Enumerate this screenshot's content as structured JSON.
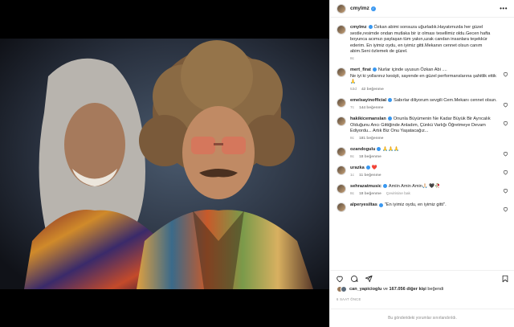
{
  "header": {
    "username": "cmylmz",
    "more_icon": "more-horizontal-icon"
  },
  "caption": {
    "username": "cmylmz",
    "text": "Özkan abimi sonsuza uğurladık.Hayatımızda her güzel sestle,resimde ondan mutlaka bir iz olması tesellimiz oldu.Gecen hafta boyunca acımızı paylaşan tüm yakın,uzak candan insanlara teşekkür ederim. En iyimiz oydu, en iyimiz gitti.Mekanın cennet olsun canım abim.Seni özlemek de güzel.",
    "time": "8c"
  },
  "comments": [
    {
      "username": "mert_firat",
      "verified": true,
      "text": "Nurlar içinde uyusun Özkan Abi ....\nNe iyi ki yollarınız kesişti, sayende en güzel performanslarına şahitlik ettik 🙏",
      "time": "53d",
      "likes": "42 beğenme"
    },
    {
      "username": "emelsayinofficial",
      "verified": true,
      "text": "Sabırlar diliyorum sevgili Cem.Mekanı cennet olsun.",
      "time": "7c",
      "likes": "144 beğenme"
    },
    {
      "username": "hakikicemanslan",
      "verified": true,
      "text": "Onunla Büyümenin Ne Kadar Büyük Bir Ayrıcalık Olduğunu Ancı Gittiğinde Anladım, Çünkü Varlığı Öğretmeye Devam Ediyordu... Artık Biz Onu Yaşatacağız...",
      "time": "8c",
      "likes": "181 beğenme"
    },
    {
      "username": "ozandogulu",
      "verified": true,
      "text": "🙏🙏🙏",
      "time": "8c",
      "likes": "18 beğenme"
    },
    {
      "username": "urazka",
      "verified": true,
      "text": "❤️",
      "time": "1c",
      "likes": "11 beğenme"
    },
    {
      "username": "sehrazatmusic",
      "verified": true,
      "text": "Amiin Amin Amin🙏🏻 🖤🥀",
      "time": "8c",
      "likes": "18 beğenme",
      "extra": "Çevirisine bak"
    },
    {
      "username": "alperyesiltas",
      "verified": true,
      "text": "\"En iyimiz oydu, en iyimiz gitti\".",
      "time": "",
      "likes": ""
    }
  ],
  "likes": {
    "first_user": "can_yapicioglu",
    "connector": "ve",
    "count": "167.056 diğer kişi",
    "suffix": "beğendi"
  },
  "timestamp": "6 SAAT ÖNCE",
  "footer_text": "Bu gönderideki yorumlar sınırlandırıldı.",
  "colors": {
    "verified": "#3897f0",
    "muted": "#8e8e8e",
    "border": "#efefef",
    "heart_red": "#ed4956"
  }
}
